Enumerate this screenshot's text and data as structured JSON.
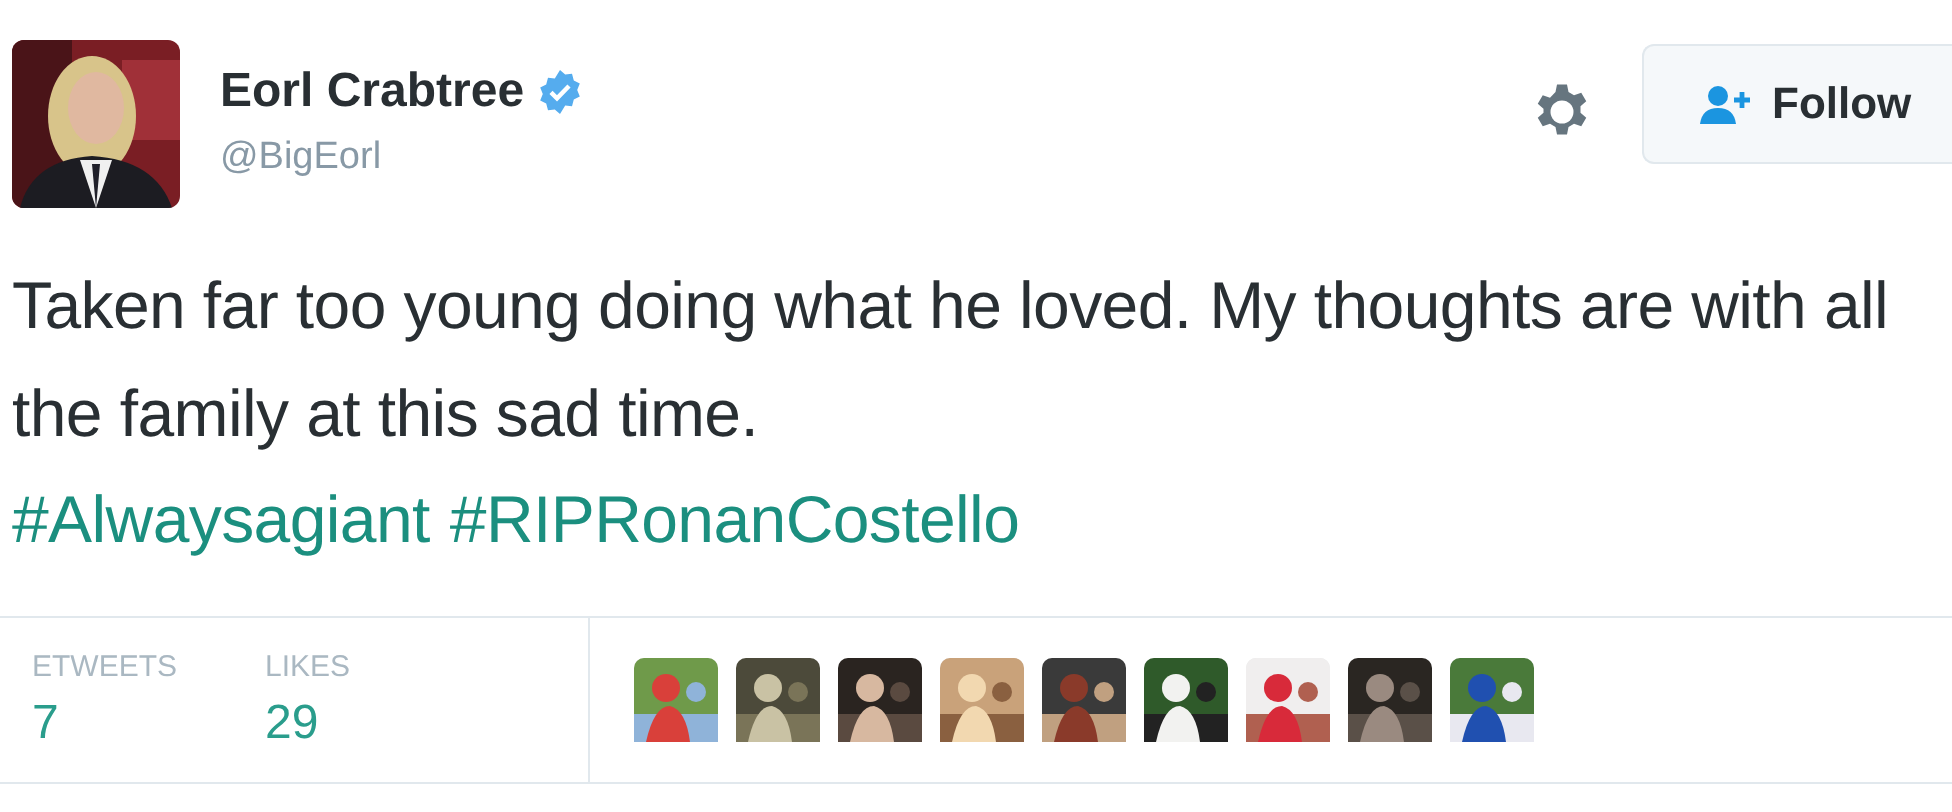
{
  "author": {
    "name": "Eorl Crabtree",
    "verified": true,
    "handle": "@BigEorl"
  },
  "follow_button": {
    "label": "Follow"
  },
  "tweet": {
    "text": "Taken far too young doing what he loved. My thoughts are with all the family at this sad time.",
    "hashtags": [
      "#Alwaysagiant",
      "#RIPRonanCostello"
    ]
  },
  "stats": [
    {
      "label": "ETWEETS",
      "value": "7"
    },
    {
      "label": "LIKES",
      "value": "29"
    }
  ]
}
